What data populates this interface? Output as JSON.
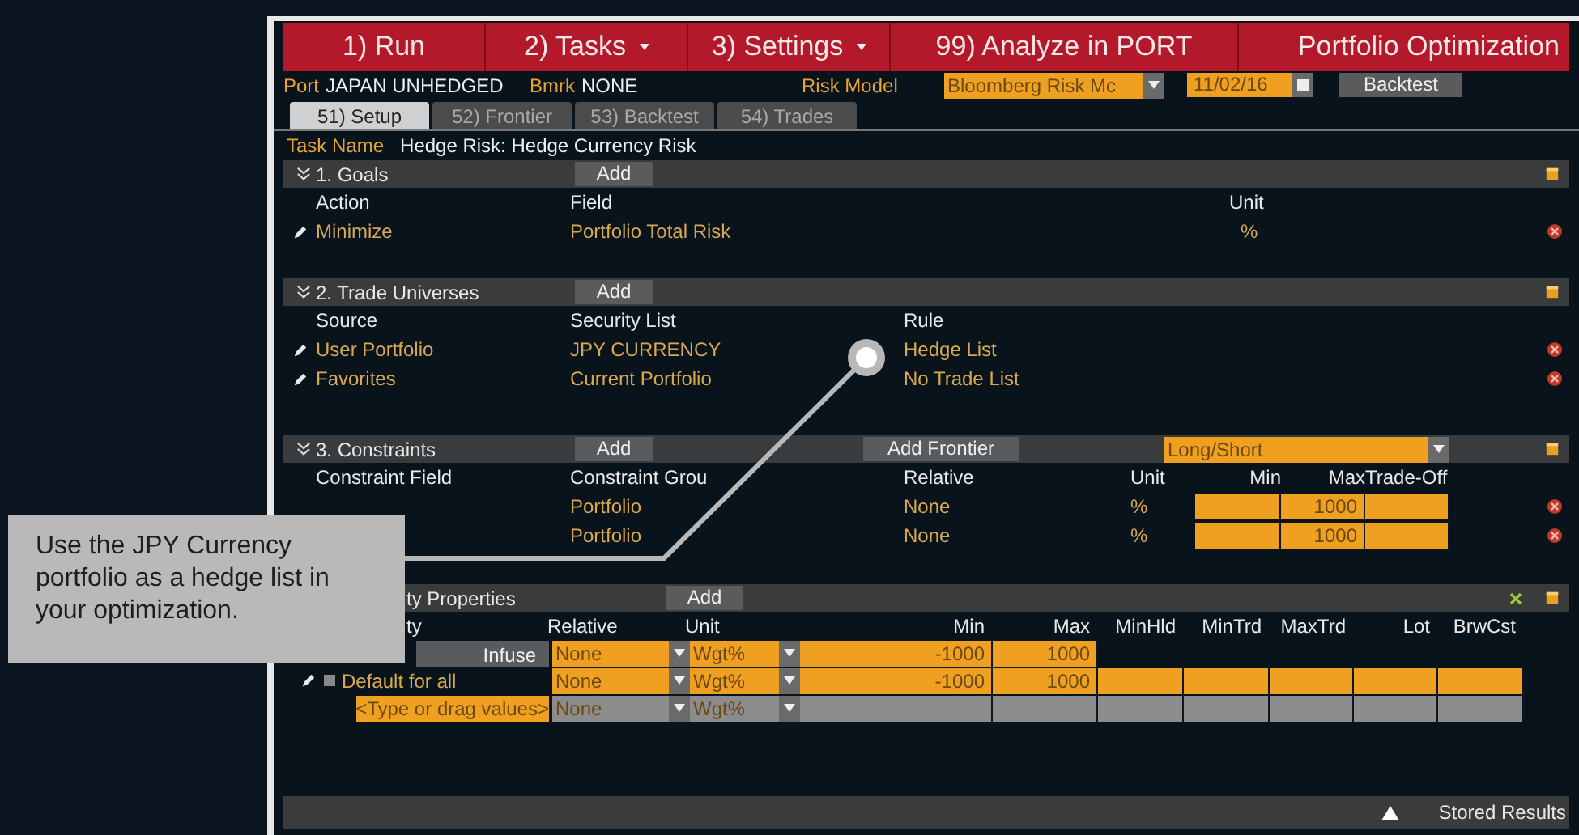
{
  "menu": {
    "items": [
      {
        "label": "1) Run",
        "dropdown": false
      },
      {
        "label": "2) Tasks",
        "dropdown": true
      },
      {
        "label": "3) Settings",
        "dropdown": true
      },
      {
        "label": "99) Analyze in PORT",
        "dropdown": false
      }
    ],
    "title": "Portfolio Optimization"
  },
  "info": {
    "port_label": "Port",
    "port": "JAPAN UNHEDGED",
    "bmrk_label": "Bmrk",
    "bmrk": "NONE",
    "risk_model_label": "Risk Model",
    "risk_model": "Bloomberg Risk Mc",
    "date": "11/02/16",
    "backtest_button": "Backtest"
  },
  "tabs": [
    {
      "label": "51) Setup",
      "selected": true
    },
    {
      "label": "52) Frontier",
      "selected": false
    },
    {
      "label": "53) Backtest",
      "selected": false
    },
    {
      "label": "54) Trades",
      "selected": false
    }
  ],
  "task_name": {
    "label": "Task Name",
    "value": "Hedge Risk: Hedge Currency Risk"
  },
  "goals": {
    "title": "1. Goals",
    "add": "Add",
    "columns": [
      "Action",
      "Field",
      "Unit"
    ],
    "rows": [
      {
        "action": "Minimize",
        "field": "Portfolio Total Risk",
        "unit": "%"
      }
    ]
  },
  "trade_universes": {
    "title": "2. Trade Universes",
    "add": "Add",
    "columns": [
      "Source",
      "Security List",
      "Rule"
    ],
    "rows": [
      {
        "source": "User Portfolio",
        "list": "JPY CURRENCY",
        "rule": "Hedge List"
      },
      {
        "source": "Favorites",
        "list": "Current Portfolio",
        "rule": "No Trade List"
      }
    ]
  },
  "constraints": {
    "title": "3. Constraints",
    "add": "Add",
    "add_frontier": "Add Frontier",
    "mode": "Long/Short",
    "columns": [
      "Constraint Field",
      "Constraint Grou",
      "Relative",
      "Unit",
      "Min",
      "Max",
      "Trade-Off"
    ],
    "rows": [
      {
        "group": "Portfolio",
        "relative": "None",
        "unit": "%",
        "max": "1000"
      },
      {
        "group": "Portfolio",
        "relative": "None",
        "unit": "%",
        "max": "1000"
      }
    ]
  },
  "security_properties": {
    "title": "ty Properties",
    "add": "Add",
    "columns": [
      "ty",
      "Relative",
      "Unit",
      "Min",
      "Max",
      "MinHld",
      "MinTrd",
      "MaxTrd",
      "Lot",
      "BrwCst"
    ],
    "rows": [
      {
        "kind": "infuse",
        "label": "Infuse",
        "relative": "None",
        "unit": "Wgt%",
        "min": "-1000",
        "max": "1000"
      },
      {
        "kind": "default",
        "label": "Default for all",
        "relative": "None",
        "unit": "Wgt%",
        "min": "-1000",
        "max": "1000"
      },
      {
        "kind": "new",
        "label": "<Type or drag values>",
        "relative": "None",
        "unit": "Wgt%"
      }
    ]
  },
  "status_bar": {
    "stored_results": "Stored Results"
  },
  "callout": {
    "text": "Use the JPY Currency portfolio as a hedge list in your optimization."
  }
}
